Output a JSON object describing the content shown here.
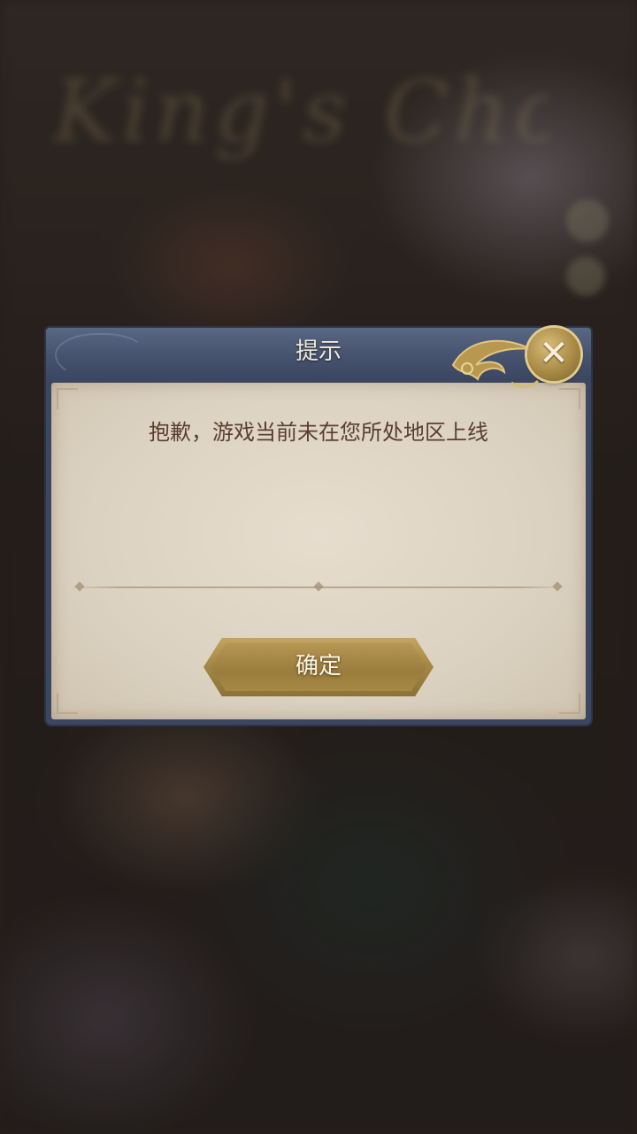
{
  "background": {
    "logo_text": "King's Choice"
  },
  "dialog": {
    "title": "提示",
    "message": "抱歉，游戏当前未在您所处地区上线",
    "confirm_label": "确定",
    "close_icon": "close-x-icon"
  },
  "colors": {
    "header_blue": "#46536e",
    "parchment": "#dcd2c1",
    "message_brown": "#5a3e2e",
    "gold": "#a68846"
  }
}
